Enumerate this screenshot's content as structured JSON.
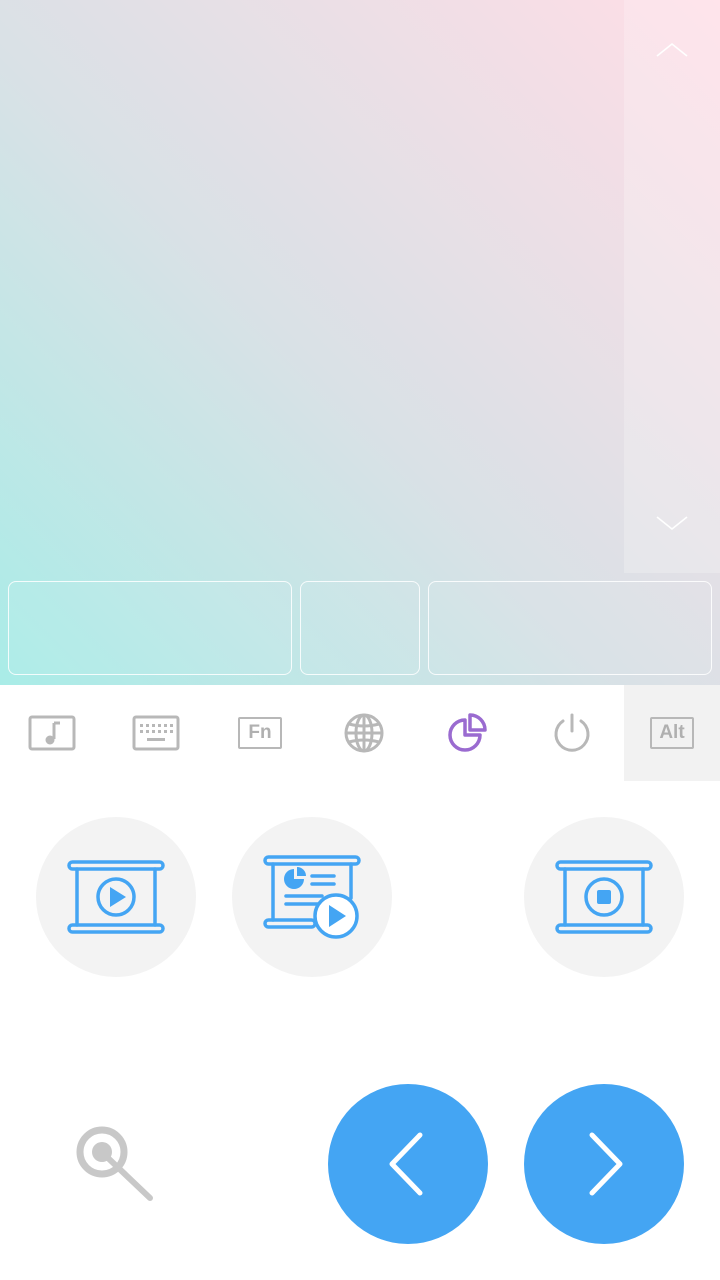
{
  "touchpad": {
    "scroll_up_icon": "chevron-up-icon",
    "scroll_down_icon": "chevron-down-icon",
    "mouse_buttons": [
      "left-click",
      "middle-click",
      "right-click"
    ]
  },
  "toolbar": {
    "items": [
      {
        "icon": "music-note-icon"
      },
      {
        "icon": "keyboard-icon"
      },
      {
        "icon": "fn-key-icon",
        "label": "Fn"
      },
      {
        "icon": "globe-icon"
      },
      {
        "icon": "pie-chart-icon",
        "active": true
      },
      {
        "icon": "power-icon"
      },
      {
        "icon": "alt-key-icon",
        "label": "Alt"
      }
    ]
  },
  "presentation": {
    "buttons": [
      {
        "icon": "slideshow-play-icon"
      },
      {
        "icon": "slideshow-from-current-icon"
      },
      {
        "icon": "slideshow-stop-icon"
      }
    ],
    "laser_icon": "laser-pointer-icon",
    "prev_icon": "chevron-left-icon",
    "next_icon": "chevron-right-icon"
  },
  "colors": {
    "accent_blue": "#44a5f3",
    "active_purple": "#9a6bd0",
    "icon_gray": "#b8b8b8"
  }
}
